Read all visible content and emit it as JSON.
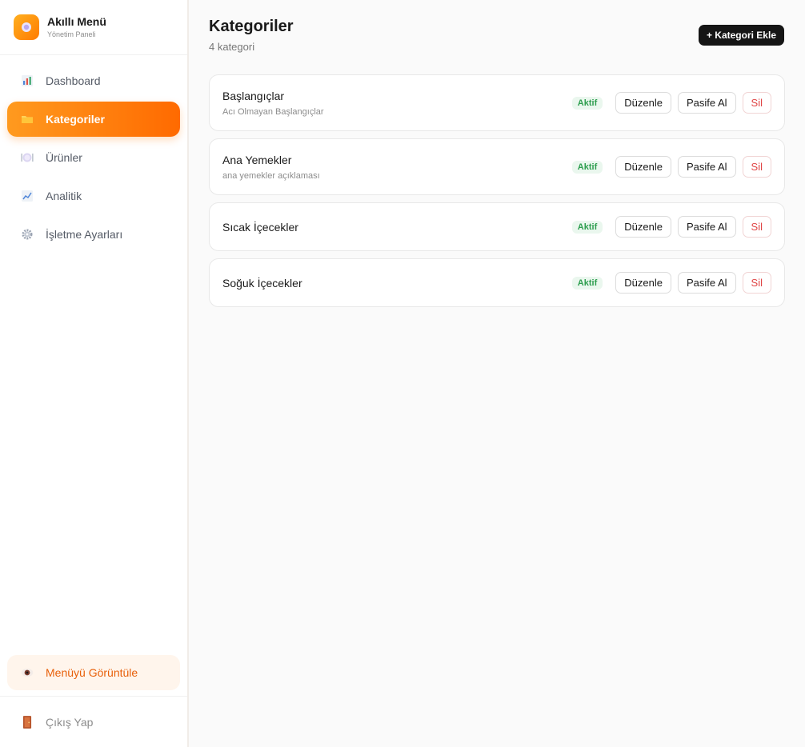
{
  "brand": {
    "title": "Akıllı Menü",
    "subtitle": "Yönetim Paneli"
  },
  "sidebar": {
    "items": [
      {
        "label": "Dashboard",
        "icon": "bar-chart-icon"
      },
      {
        "label": "Kategoriler",
        "icon": "folder-icon",
        "active": true
      },
      {
        "label": "Ürünler",
        "icon": "plate-icon"
      },
      {
        "label": "Analitik",
        "icon": "line-chart-icon"
      },
      {
        "label": "İşletme Ayarları",
        "icon": "gear-icon"
      }
    ],
    "view_menu": {
      "label": "Menüyü Görüntüle",
      "icon": "eye-icon"
    },
    "logout": {
      "label": "Çıkış Yap",
      "icon": "door-icon"
    }
  },
  "header": {
    "title": "Kategoriler",
    "count": "4 kategori",
    "add_button": "+ Kategori Ekle"
  },
  "categories": [
    {
      "name": "Başlangıçlar",
      "description": "Acı Olmayan Başlangıçlar",
      "status": "Aktif",
      "edit": "Düzenle",
      "toggle": "Pasife Al",
      "delete": "Sil"
    },
    {
      "name": "Ana Yemekler",
      "description": "ana yemekler açıklaması",
      "status": "Aktif",
      "edit": "Düzenle",
      "toggle": "Pasife Al",
      "delete": "Sil"
    },
    {
      "name": "Sıcak İçecekler",
      "description": "",
      "status": "Aktif",
      "edit": "Düzenle",
      "toggle": "Pasife Al",
      "delete": "Sil"
    },
    {
      "name": "Soğuk İçecekler",
      "description": "",
      "status": "Aktif",
      "edit": "Düzenle",
      "toggle": "Pasife Al",
      "delete": "Sil"
    }
  ],
  "colors": {
    "accent": "#ff7a00",
    "status_green": "#2e9e4f",
    "danger": "#e04646"
  }
}
